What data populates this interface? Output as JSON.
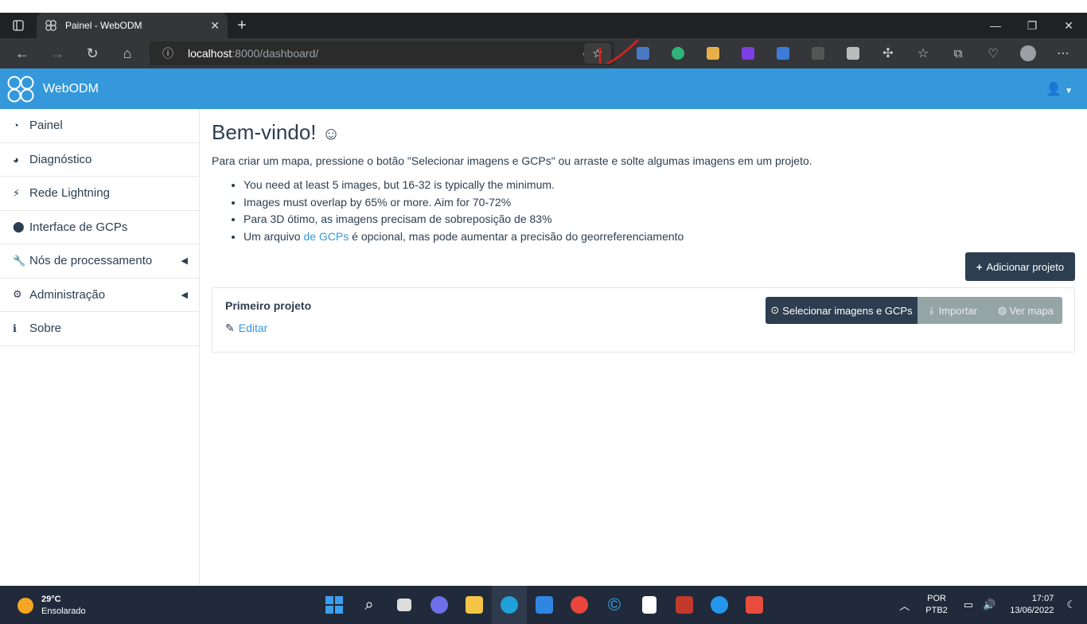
{
  "browser": {
    "tab_title": "Painel - WebODM",
    "url_host": "localhost",
    "url_rest": ":8000/dashboard/"
  },
  "app": {
    "brand": "WebODM"
  },
  "sidebar": {
    "items": [
      {
        "label": "Painel",
        "icon": "dashboard-icon"
      },
      {
        "label": "Diagnóstico",
        "icon": "pie-chart-icon"
      },
      {
        "label": "Rede Lightning",
        "icon": "bolt-icon"
      },
      {
        "label": "Interface de GCPs",
        "icon": "map-marker-icon"
      },
      {
        "label": "Nós de processamento",
        "icon": "wrench-icon"
      },
      {
        "label": "Administração",
        "icon": "cogs-icon"
      },
      {
        "label": "Sobre",
        "icon": "info-icon"
      }
    ]
  },
  "main": {
    "title": "Bem-vindo!",
    "title_emoji": "☺",
    "intro": "Para criar um mapa, pressione o botão \"Selecionar imagens e GCPs\" ou arraste e solte algumas imagens em um projeto.",
    "tips": [
      "You need at least 5 images, but 16-32 is typically the minimum.",
      "Images must overlap by 65% or more. Aim for 70-72%",
      "Para 3D ótimo, as imagens precisam de sobreposição de 83%"
    ],
    "tip4_before": "Um arquivo ",
    "tip4_link": "de GCPs",
    "tip4_after": " é opcional, mas pode aumentar a precisão do georreferenciamento",
    "add_project_label": "Adicionar projeto"
  },
  "project": {
    "name": "Primeiro projeto",
    "edit_label": "Editar",
    "select_images_label": "Selecionar imagens e GCPs",
    "import_label": "Importar",
    "view_map_label": "Ver mapa"
  },
  "taskbar": {
    "temperature": "29°C",
    "weather": "Ensolarado",
    "lang_top": "POR",
    "lang_bottom": "PTB2",
    "time": "17:07",
    "date": "13/06/2022"
  },
  "colors": {
    "brand_blue": "#3498db",
    "dark": "#2c3e50",
    "muted_button": "#95a5a6"
  }
}
